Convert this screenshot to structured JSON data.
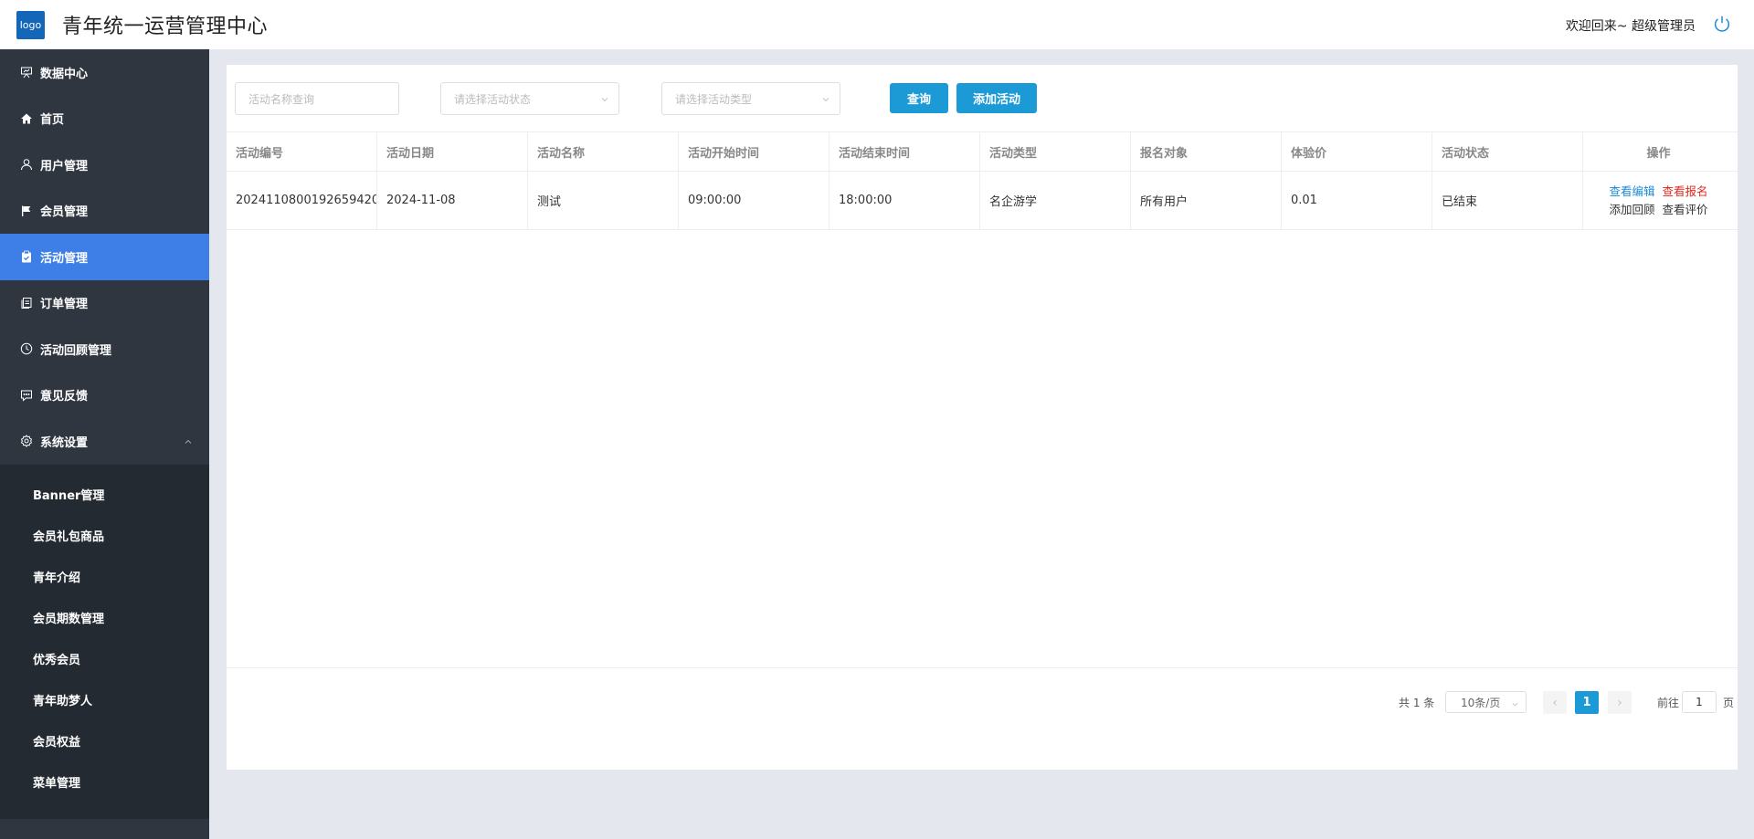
{
  "header": {
    "logo_text": "logo",
    "title": "青年统一运营管理中心",
    "welcome": "欢迎回来~ 超级管理员"
  },
  "sidebar": {
    "items": [
      {
        "label": "数据中心",
        "icon": "presentation-icon"
      },
      {
        "label": "首页",
        "icon": "home-icon"
      },
      {
        "label": "用户管理",
        "icon": "user-icon"
      },
      {
        "label": "会员管理",
        "icon": "flag-icon"
      },
      {
        "label": "活动管理",
        "icon": "clipboard-icon",
        "active": true
      },
      {
        "label": "订单管理",
        "icon": "documents-icon"
      },
      {
        "label": "活动回顾管理",
        "icon": "clock-icon"
      },
      {
        "label": "意见反馈",
        "icon": "chat-icon"
      },
      {
        "label": "系统设置",
        "icon": "gear-icon",
        "expanded": true
      }
    ],
    "subitems": [
      "Banner管理",
      "会员礼包商品",
      "青年介绍",
      "会员期数管理",
      "优秀会员",
      "青年助梦人",
      "会员权益",
      "菜单管理"
    ]
  },
  "filters": {
    "name_placeholder": "活动名称查询",
    "status_placeholder": "请选择活动状态",
    "type_placeholder": "请选择活动类型",
    "query_label": "查询",
    "add_label": "添加活动"
  },
  "table": {
    "headers": [
      "活动编号",
      "活动日期",
      "活动名称",
      "活动开始时间",
      "活动结束时间",
      "活动类型",
      "报名对象",
      "体验价",
      "活动状态",
      "操作"
    ],
    "rows": [
      {
        "id": "2024110800192659420…",
        "date": "2024-11-08",
        "name": "测试",
        "start": "09:00:00",
        "end": "18:00:00",
        "type": "名企游学",
        "target": "所有用户",
        "price": "0.01",
        "status": "已结束",
        "ops": [
          "查看编辑",
          "查看报名",
          "添加回顾",
          "查看评价"
        ]
      }
    ]
  },
  "pagination": {
    "total": "共 1 条",
    "page_size": "10条/页",
    "current_page": "1",
    "goto_label": "前往",
    "goto_value": "1",
    "page_suffix": "页"
  },
  "colors": {
    "sidebar_bg": "#2f3640",
    "active_bg": "#3d7fe6",
    "primary_button": "#1b9ad6",
    "op_edit": "#1b8ad6",
    "op_signup": "#e0281d"
  }
}
